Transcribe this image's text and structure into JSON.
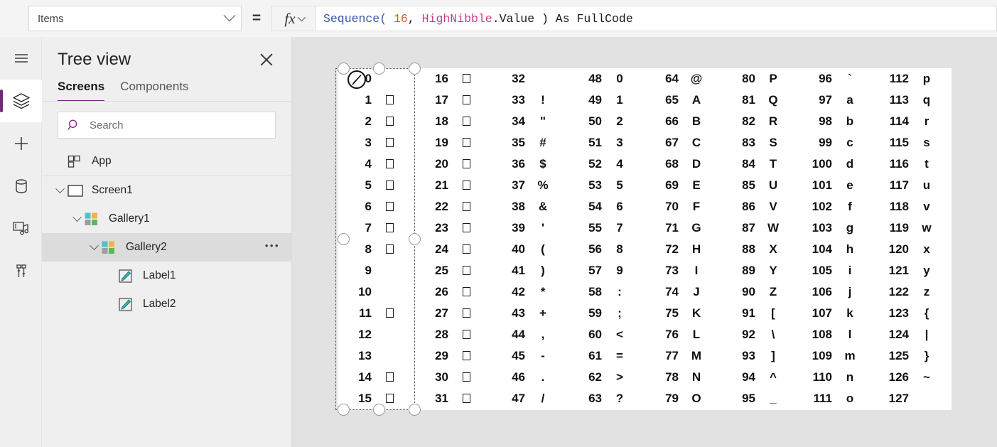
{
  "formula_bar": {
    "property_value": "Items",
    "property_dropdown_icon": "chevron-down-icon",
    "equals": "=",
    "fx_label": "fx",
    "fx_dropdown_icon": "chevron-down-icon",
    "formula_tokens": [
      {
        "text": "Sequence(",
        "type": "fn"
      },
      {
        "text": " ",
        "type": "plain"
      },
      {
        "text": "16",
        "type": "num"
      },
      {
        "text": ", ",
        "type": "plain"
      },
      {
        "text": "HighNibble",
        "type": "var"
      },
      {
        "text": ".Value ) As FullCode",
        "type": "plain"
      }
    ],
    "formula_text": "Sequence( 16, HighNibble.Value ) As FullCode"
  },
  "rail": {
    "items": [
      {
        "icon": "hamburger-menu-icon",
        "name": "menu",
        "active": false
      },
      {
        "icon": "layers-tree-view-icon",
        "name": "tree-view",
        "active": true
      },
      {
        "icon": "plus-insert-icon",
        "name": "insert",
        "active": false
      },
      {
        "icon": "database-data-icon",
        "name": "data",
        "active": false
      },
      {
        "icon": "media-icon",
        "name": "media",
        "active": false
      },
      {
        "icon": "advanced-tools-icon",
        "name": "advanced",
        "active": false
      }
    ],
    "accent": "#742774"
  },
  "tree_panel": {
    "title": "Tree view",
    "close_icon": "close-icon",
    "tabs": [
      {
        "label": "Screens",
        "selected": true
      },
      {
        "label": "Components",
        "selected": false
      }
    ],
    "search": {
      "placeholder": "Search",
      "icon": "search-icon",
      "value": ""
    },
    "items": [
      {
        "label": "App",
        "indent": 0,
        "caret": false,
        "icon": "app-icon",
        "selected": false,
        "overflow": false
      },
      {
        "label": "Screen1",
        "indent": 0,
        "caret": true,
        "icon": "screen-icon",
        "selected": false,
        "overflow": false
      },
      {
        "label": "Gallery1",
        "indent": 1,
        "caret": true,
        "icon": "gallery-icon",
        "selected": false,
        "overflow": false
      },
      {
        "label": "Gallery2",
        "indent": 2,
        "caret": true,
        "icon": "gallery-icon",
        "selected": true,
        "overflow": true
      },
      {
        "label": "Label1",
        "indent": 3,
        "caret": false,
        "icon": "label-icon",
        "selected": false,
        "overflow": false
      },
      {
        "label": "Label2",
        "indent": 3,
        "caret": false,
        "icon": "label-icon",
        "selected": false,
        "overflow": false
      }
    ],
    "overflow_icon": "more-options-icon"
  },
  "canvas": {
    "selected_control": "Gallery2",
    "selection_cursor_icon": "pen-edit-cursor-icon",
    "ascii_table": {
      "columns": [
        {
          "start": 0,
          "codes": [
            {
              "n": "0",
              "g": ""
            },
            {
              "n": "1",
              "g": "box"
            },
            {
              "n": "2",
              "g": "box"
            },
            {
              "n": "3",
              "g": "box"
            },
            {
              "n": "4",
              "g": "box"
            },
            {
              "n": "5",
              "g": "box"
            },
            {
              "n": "6",
              "g": "box"
            },
            {
              "n": "7",
              "g": "box"
            },
            {
              "n": "8",
              "g": "box"
            },
            {
              "n": "9",
              "g": ""
            },
            {
              "n": "10",
              "g": ""
            },
            {
              "n": "11",
              "g": "box"
            },
            {
              "n": "12",
              "g": ""
            },
            {
              "n": "13",
              "g": ""
            },
            {
              "n": "14",
              "g": "box"
            },
            {
              "n": "15",
              "g": "box"
            }
          ]
        },
        {
          "start": 16,
          "codes": [
            {
              "n": "16",
              "g": "box"
            },
            {
              "n": "17",
              "g": "box"
            },
            {
              "n": "18",
              "g": "box"
            },
            {
              "n": "19",
              "g": "box"
            },
            {
              "n": "20",
              "g": "box"
            },
            {
              "n": "21",
              "g": "box"
            },
            {
              "n": "22",
              "g": "box"
            },
            {
              "n": "23",
              "g": "box"
            },
            {
              "n": "24",
              "g": "box"
            },
            {
              "n": "25",
              "g": "box"
            },
            {
              "n": "26",
              "g": "box"
            },
            {
              "n": "27",
              "g": "box"
            },
            {
              "n": "28",
              "g": "box"
            },
            {
              "n": "29",
              "g": "box"
            },
            {
              "n": "30",
              "g": "box"
            },
            {
              "n": "31",
              "g": "box"
            }
          ]
        },
        {
          "start": 32,
          "codes": [
            {
              "n": "32",
              "g": ""
            },
            {
              "n": "33",
              "g": "!"
            },
            {
              "n": "34",
              "g": "\""
            },
            {
              "n": "35",
              "g": "#"
            },
            {
              "n": "36",
              "g": "$"
            },
            {
              "n": "37",
              "g": "%"
            },
            {
              "n": "38",
              "g": "&"
            },
            {
              "n": "39",
              "g": "'"
            },
            {
              "n": "40",
              "g": "("
            },
            {
              "n": "41",
              "g": ")"
            },
            {
              "n": "42",
              "g": "*"
            },
            {
              "n": "43",
              "g": "+"
            },
            {
              "n": "44",
              "g": ","
            },
            {
              "n": "45",
              "g": "-"
            },
            {
              "n": "46",
              "g": "."
            },
            {
              "n": "47",
              "g": "/"
            }
          ]
        },
        {
          "start": 48,
          "codes": [
            {
              "n": "48",
              "g": "0"
            },
            {
              "n": "49",
              "g": "1"
            },
            {
              "n": "50",
              "g": "2"
            },
            {
              "n": "51",
              "g": "3"
            },
            {
              "n": "52",
              "g": "4"
            },
            {
              "n": "53",
              "g": "5"
            },
            {
              "n": "54",
              "g": "6"
            },
            {
              "n": "55",
              "g": "7"
            },
            {
              "n": "56",
              "g": "8"
            },
            {
              "n": "57",
              "g": "9"
            },
            {
              "n": "58",
              "g": ":"
            },
            {
              "n": "59",
              "g": ";"
            },
            {
              "n": "60",
              "g": "<"
            },
            {
              "n": "61",
              "g": "="
            },
            {
              "n": "62",
              "g": ">"
            },
            {
              "n": "63",
              "g": "?"
            }
          ]
        },
        {
          "start": 64,
          "codes": [
            {
              "n": "64",
              "g": "@"
            },
            {
              "n": "65",
              "g": "A"
            },
            {
              "n": "66",
              "g": "B"
            },
            {
              "n": "67",
              "g": "C"
            },
            {
              "n": "68",
              "g": "D"
            },
            {
              "n": "69",
              "g": "E"
            },
            {
              "n": "70",
              "g": "F"
            },
            {
              "n": "71",
              "g": "G"
            },
            {
              "n": "72",
              "g": "H"
            },
            {
              "n": "73",
              "g": "I"
            },
            {
              "n": "74",
              "g": "J"
            },
            {
              "n": "75",
              "g": "K"
            },
            {
              "n": "76",
              "g": "L"
            },
            {
              "n": "77",
              "g": "M"
            },
            {
              "n": "78",
              "g": "N"
            },
            {
              "n": "79",
              "g": "O"
            }
          ]
        },
        {
          "start": 80,
          "codes": [
            {
              "n": "80",
              "g": "P"
            },
            {
              "n": "81",
              "g": "Q"
            },
            {
              "n": "82",
              "g": "R"
            },
            {
              "n": "83",
              "g": "S"
            },
            {
              "n": "84",
              "g": "T"
            },
            {
              "n": "85",
              "g": "U"
            },
            {
              "n": "86",
              "g": "V"
            },
            {
              "n": "87",
              "g": "W"
            },
            {
              "n": "88",
              "g": "X"
            },
            {
              "n": "89",
              "g": "Y"
            },
            {
              "n": "90",
              "g": "Z"
            },
            {
              "n": "91",
              "g": "["
            },
            {
              "n": "92",
              "g": "\\"
            },
            {
              "n": "93",
              "g": "]"
            },
            {
              "n": "94",
              "g": "^"
            },
            {
              "n": "95",
              "g": "_"
            }
          ]
        },
        {
          "start": 96,
          "codes": [
            {
              "n": "96",
              "g": "`"
            },
            {
              "n": "97",
              "g": "a"
            },
            {
              "n": "98",
              "g": "b"
            },
            {
              "n": "99",
              "g": "c"
            },
            {
              "n": "100",
              "g": "d"
            },
            {
              "n": "101",
              "g": "e"
            },
            {
              "n": "102",
              "g": "f"
            },
            {
              "n": "103",
              "g": "g"
            },
            {
              "n": "104",
              "g": "h"
            },
            {
              "n": "105",
              "g": "i"
            },
            {
              "n": "106",
              "g": "j"
            },
            {
              "n": "107",
              "g": "k"
            },
            {
              "n": "108",
              "g": "l"
            },
            {
              "n": "109",
              "g": "m"
            },
            {
              "n": "110",
              "g": "n"
            },
            {
              "n": "111",
              "g": "o"
            }
          ]
        },
        {
          "start": 112,
          "codes": [
            {
              "n": "112",
              "g": "p"
            },
            {
              "n": "113",
              "g": "q"
            },
            {
              "n": "114",
              "g": "r"
            },
            {
              "n": "115",
              "g": "s"
            },
            {
              "n": "116",
              "g": "t"
            },
            {
              "n": "117",
              "g": "u"
            },
            {
              "n": "118",
              "g": "v"
            },
            {
              "n": "119",
              "g": "w"
            },
            {
              "n": "120",
              "g": "x"
            },
            {
              "n": "121",
              "g": "y"
            },
            {
              "n": "122",
              "g": "z"
            },
            {
              "n": "123",
              "g": "{"
            },
            {
              "n": "124",
              "g": "|"
            },
            {
              "n": "125",
              "g": "}"
            },
            {
              "n": "126",
              "g": "~"
            },
            {
              "n": "127",
              "g": ""
            }
          ]
        }
      ]
    }
  }
}
